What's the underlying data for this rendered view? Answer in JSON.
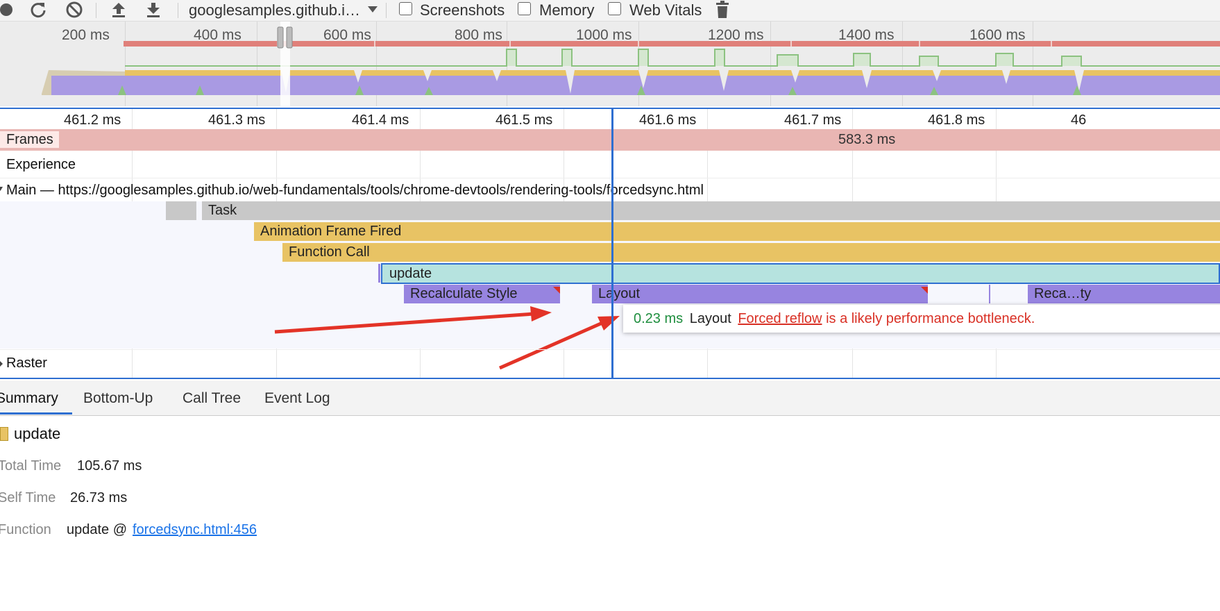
{
  "toolbar": {
    "url_label": "googlesamples.github.i…",
    "screenshots_label": "Screenshots",
    "memory_label": "Memory",
    "web_vitals_label": "Web Vitals"
  },
  "overview": {
    "ticks": [
      "200 ms",
      "400 ms",
      "600 ms",
      "800 ms",
      "1000 ms",
      "1200 ms",
      "1400 ms",
      "1600 ms"
    ]
  },
  "ruler": {
    "ticks": [
      "461.2 ms",
      "461.3 ms",
      "461.4 ms",
      "461.5 ms",
      "461.6 ms",
      "461.7 ms",
      "461.8 ms",
      "46"
    ]
  },
  "tracks": {
    "frames_label": "Frames",
    "frames_value": "583.3 ms",
    "experience_label": "Experience",
    "main_label": "Main — https://googlesamples.github.io/web-fundamentals/tools/chrome-devtools/rendering-tools/forcedsync.html",
    "raster_label": "Raster"
  },
  "flame": {
    "task": "Task",
    "animation_frame": "Animation Frame Fired",
    "function_call": "Function Call",
    "update": "update",
    "recalc_style": "Recalculate Style",
    "layout": "Layout",
    "recalc_truncated": "Reca…ty"
  },
  "tooltip": {
    "time": "0.23 ms",
    "name": "Layout",
    "link": "Forced reflow",
    "message": "is a likely performance bottleneck."
  },
  "tabs": [
    "Summary",
    "Bottom-Up",
    "Call Tree",
    "Event Log"
  ],
  "summary": {
    "title": "update",
    "total_time_label": "Total Time",
    "total_time": "105.67 ms",
    "self_time_label": "Self Time",
    "self_time": "26.73 ms",
    "function_label": "Function",
    "function_value": "update @",
    "function_link": "forcedsync.html:456"
  },
  "colors": {
    "scripting": "#e8c364",
    "rendering": "#9784e0",
    "selected": "#b6e3df",
    "task": "#c8c8c8",
    "frames": "#e9b6b3",
    "selection_blue": "#2f6fd1",
    "warning_red": "#d93025",
    "time_green": "#1e8e3e"
  }
}
